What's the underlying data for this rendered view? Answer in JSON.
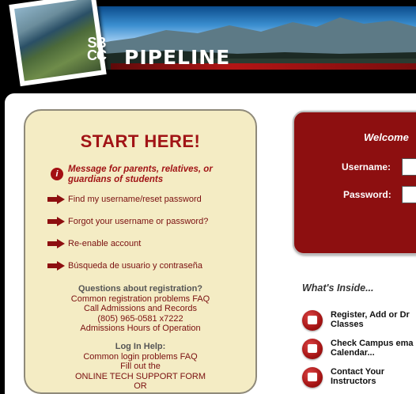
{
  "header": {
    "logo_line1": "SB",
    "logo_line2": "CC",
    "title": "PIPELINE"
  },
  "start": {
    "heading": "START HERE!",
    "info_icon": "info-icon",
    "info_message": "Message for parents, relatives, or guardians of students",
    "links": [
      "Find my username/reset password",
      "Forgot your username or password?",
      "Re-enable account",
      "Búsqueda de usuario y contraseña"
    ]
  },
  "registration": {
    "heading": "Questions about registration?",
    "faq_link": "Common registration problems FAQ",
    "call_text": "Call Admissions and Records",
    "phone": "(805) 965-0581 x7222",
    "hours_link": "Admissions Hours of Operation"
  },
  "login_help": {
    "heading": "Log In Help:",
    "faq_link": "Common login problems FAQ",
    "fill_out": "Fill out the",
    "support_form_link": "ONLINE TECH SUPPORT FORM",
    "or_text": "OR"
  },
  "login": {
    "welcome": "Welcome",
    "username_label": "Username:",
    "password_label": "Password:",
    "username_value": "",
    "password_value": ""
  },
  "inside": {
    "heading": "What's Inside...",
    "items": [
      {
        "icon": "checkbox-icon",
        "line1": "Register, Add or Dr",
        "line2": "Classes"
      },
      {
        "icon": "envelope-icon",
        "line1": "Check Campus ema",
        "line2": "Calendar..."
      },
      {
        "icon": "apple-icon",
        "line1": "Contact Your",
        "line2": "Instructors"
      }
    ]
  },
  "colors": {
    "accent_red": "#8d0f10",
    "panel_cream": "#f4ecc4"
  }
}
